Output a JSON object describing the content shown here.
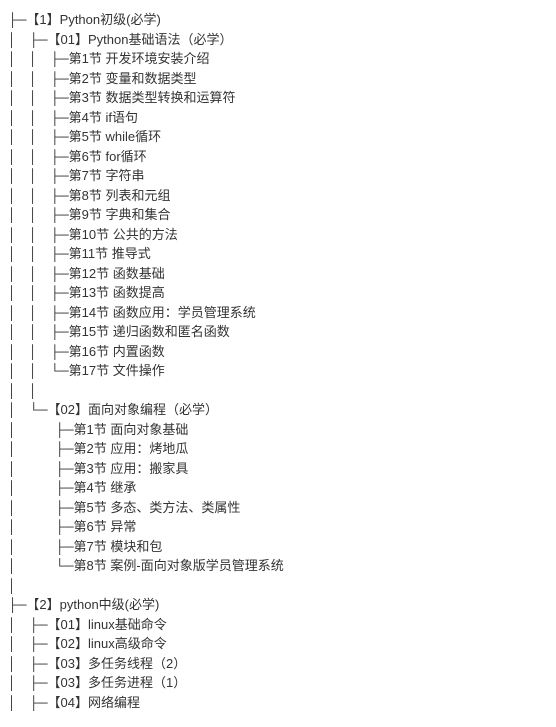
{
  "tree": [
    {
      "prefix": "├─",
      "label": "【1】Python初级(必学)"
    },
    {
      "prefix": "│　├─",
      "label": "【01】Python基础语法（必学）"
    },
    {
      "prefix": "│　│　├─",
      "label": "第1节  开发环境安装介绍"
    },
    {
      "prefix": "│　│　├─",
      "label": "第2节  变量和数据类型"
    },
    {
      "prefix": "│　│　├─",
      "label": "第3节  数据类型转换和运算符"
    },
    {
      "prefix": "│　│　├─",
      "label": "第4节  if语句"
    },
    {
      "prefix": "│　│　├─",
      "label": "第5节  while循环"
    },
    {
      "prefix": "│　│　├─",
      "label": "第6节   for循环"
    },
    {
      "prefix": "│　│　├─",
      "label": "第7节  字符串"
    },
    {
      "prefix": "│　│　├─",
      "label": "第8节  列表和元组"
    },
    {
      "prefix": "│　│　├─",
      "label": "第9节  字典和集合"
    },
    {
      "prefix": "│　│　├─",
      "label": "第10节  公共的方法"
    },
    {
      "prefix": "│　│　├─",
      "label": "第11节  推导式"
    },
    {
      "prefix": "│　│　├─",
      "label": "第12节  函数基础"
    },
    {
      "prefix": "│　│　├─",
      "label": "第13节  函数提高"
    },
    {
      "prefix": "│　│　├─",
      "label": "第14节  函数应用：学员管理系统"
    },
    {
      "prefix": "│　│　├─",
      "label": "第15节  递归函数和匿名函数"
    },
    {
      "prefix": "│　│　├─",
      "label": "第16节  内置函数"
    },
    {
      "prefix": "│　│　└─",
      "label": "第17节  文件操作"
    },
    {
      "prefix": "│　│",
      "label": ""
    },
    {
      "prefix": "│　└─",
      "label": "【02】面向对象编程（必学）"
    },
    {
      "prefix": "│　　　├─",
      "label": "第1节    面向对象基础"
    },
    {
      "prefix": "│　　　├─",
      "label": "第2节    应用：烤地瓜"
    },
    {
      "prefix": "│　　　├─",
      "label": "第3节    应用：搬家具"
    },
    {
      "prefix": "│　　　├─",
      "label": "第4节    继承"
    },
    {
      "prefix": "│　　　├─",
      "label": "第5节    多态、类方法、类属性"
    },
    {
      "prefix": "│　　　├─",
      "label": "第6节    异常"
    },
    {
      "prefix": "│　　　├─",
      "label": "第7节    模块和包"
    },
    {
      "prefix": "│　　　└─",
      "label": "第8节    案例-面向对象版学员管理系统"
    },
    {
      "prefix": "│",
      "label": ""
    },
    {
      "prefix": "├─",
      "label": "【2】python中级(必学)"
    },
    {
      "prefix": "│　├─",
      "label": "【01】linux基础命令"
    },
    {
      "prefix": "│　├─",
      "label": "【02】linux高级命令"
    },
    {
      "prefix": "│　├─",
      "label": "【03】多任务线程（2）"
    },
    {
      "prefix": "│　├─",
      "label": "【03】多任务进程（1）"
    },
    {
      "prefix": "│　├─",
      "label": "【04】网络编程"
    }
  ]
}
